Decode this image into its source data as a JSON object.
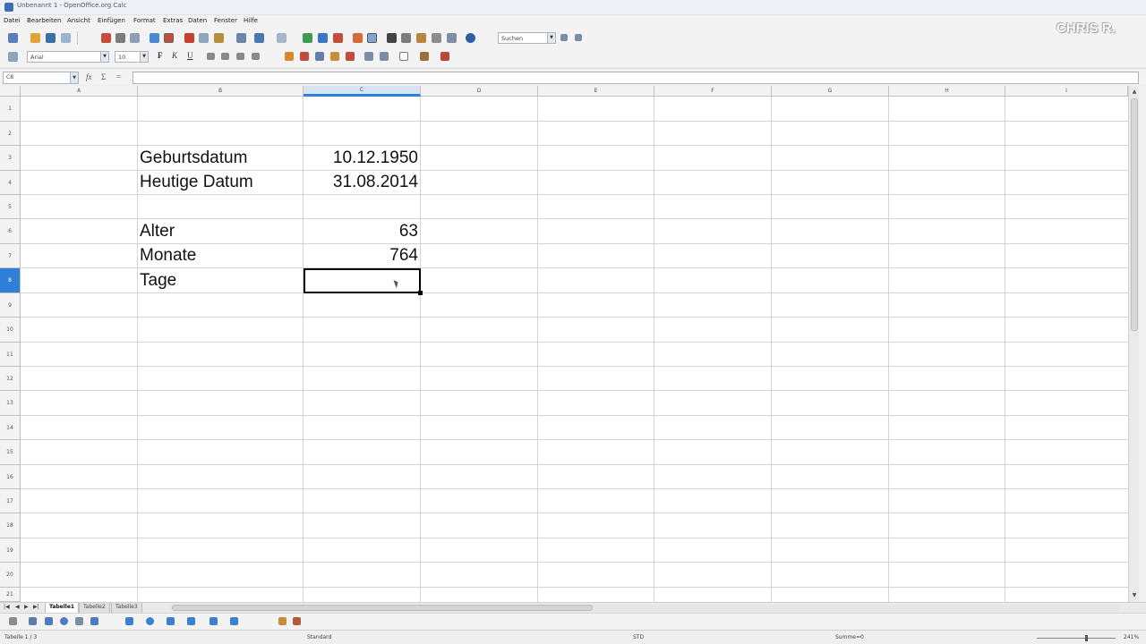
{
  "window": {
    "title": "Unbenannt 1 - OpenOffice.org Calc"
  },
  "menu": [
    "Datei",
    "Bearbeiten",
    "Ansicht",
    "Einfügen",
    "Format",
    "Extras",
    "Daten",
    "Fenster",
    "Hilfe"
  ],
  "toolbar": {
    "search_placeholder": "Suchen",
    "font_name": "Arial",
    "font_size": "10",
    "bold_label": "F",
    "italic_label": "K",
    "underline_label": "U"
  },
  "watermark": "CHRIS R.",
  "formula_bar": {
    "cell_ref": "C8",
    "func_wizard": "fx",
    "sum_label": "Σ",
    "equals_label": "=",
    "content": ""
  },
  "columns": [
    "A",
    "B",
    "C",
    "D",
    "E",
    "F",
    "G",
    "H",
    "I"
  ],
  "active_column": "C",
  "rows": [
    "1",
    "2",
    "3",
    "4",
    "5",
    "6",
    "7",
    "8",
    "9",
    "10",
    "11",
    "12",
    "13",
    "14",
    "15",
    "16",
    "17",
    "18",
    "19",
    "20",
    "21"
  ],
  "active_row": "8",
  "cells": [
    {
      "ref": "B3",
      "value": "Geburtsdatum"
    },
    {
      "ref": "C3",
      "value": "10.12.1950"
    },
    {
      "ref": "B4",
      "value": "Heutige Datum"
    },
    {
      "ref": "C4",
      "value": "31.08.2014"
    },
    {
      "ref": "B6",
      "value": "Alter"
    },
    {
      "ref": "C6",
      "value": "63"
    },
    {
      "ref": "B7",
      "value": "Monate"
    },
    {
      "ref": "C7",
      "value": "764"
    },
    {
      "ref": "B8",
      "value": "Tage"
    }
  ],
  "sheet_tabs": [
    "Tabelle1",
    "Tabelle2",
    "Tabelle3"
  ],
  "active_sheet": "Tabelle1",
  "status": {
    "sheet": "Tabelle 1 / 3",
    "style": "Standard",
    "mode": "STD",
    "sum": "Summe=0",
    "zoom": "241%"
  },
  "colors": {
    "accent": "#2f7fd6",
    "grid": "#d4d4d4",
    "header_bg": "#f3f3f3"
  }
}
